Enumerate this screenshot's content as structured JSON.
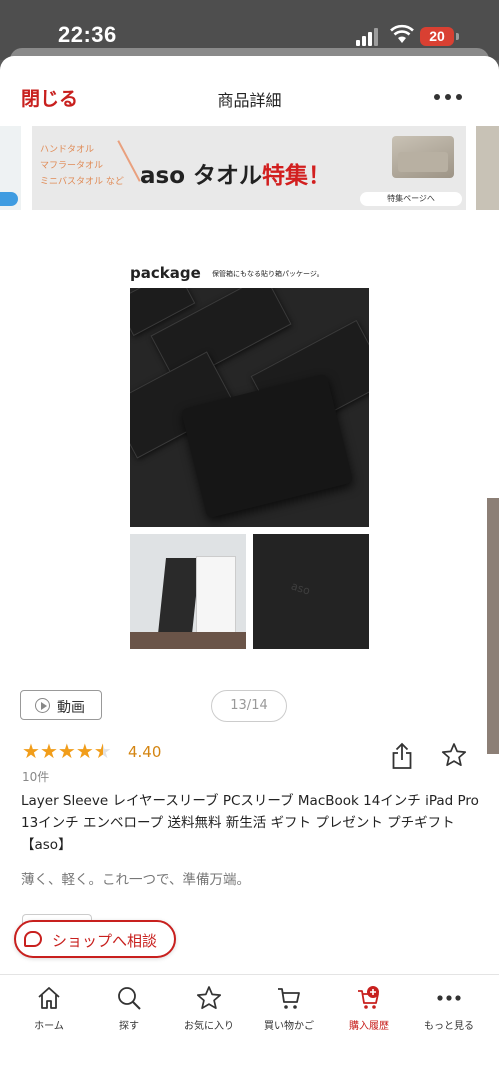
{
  "status_bar": {
    "time": "22:36",
    "battery": "20"
  },
  "nav": {
    "close_label": "閉じる",
    "title": "商品詳細"
  },
  "banner": {
    "items": [
      "ハンドタオル",
      "マフラータオル",
      "ミニバスタオル など"
    ],
    "headline_prefix": "aso タオル",
    "headline_highlight": "特集！",
    "button_label": "特集ページへ"
  },
  "product_image": {
    "title": "package",
    "subtitle": "保管箱にもなる貼り箱パッケージ。",
    "logo_text": "aso"
  },
  "video": {
    "label": "動画"
  },
  "gallery": {
    "counter": "13/14"
  },
  "rating": {
    "value": "4.40",
    "stars": 4.4,
    "count": "10件"
  },
  "product": {
    "name": "Layer Sleeve レイヤースリーブ PCスリーブ MacBook 14インチ iPad Pro 13インチ エンベロープ 送料無料 新生活 ギフト プレゼント プチギフト 【aso】",
    "catch": "薄く、軽く。これ一つで、準備万端。"
  },
  "consult": {
    "label": "ショップへ相談"
  },
  "tabbar": {
    "items": [
      {
        "label": "ホーム",
        "icon": "home-icon"
      },
      {
        "label": "探す",
        "icon": "search-icon"
      },
      {
        "label": "お気に入り",
        "icon": "star-icon"
      },
      {
        "label": "買い物かご",
        "icon": "cart-icon"
      },
      {
        "label": "購入履歴",
        "icon": "history-icon"
      },
      {
        "label": "もっと見る",
        "icon": "more-icon"
      }
    ],
    "active_index": 4
  },
  "colors": {
    "accent": "#c8201e",
    "star": "#f19d1a"
  }
}
